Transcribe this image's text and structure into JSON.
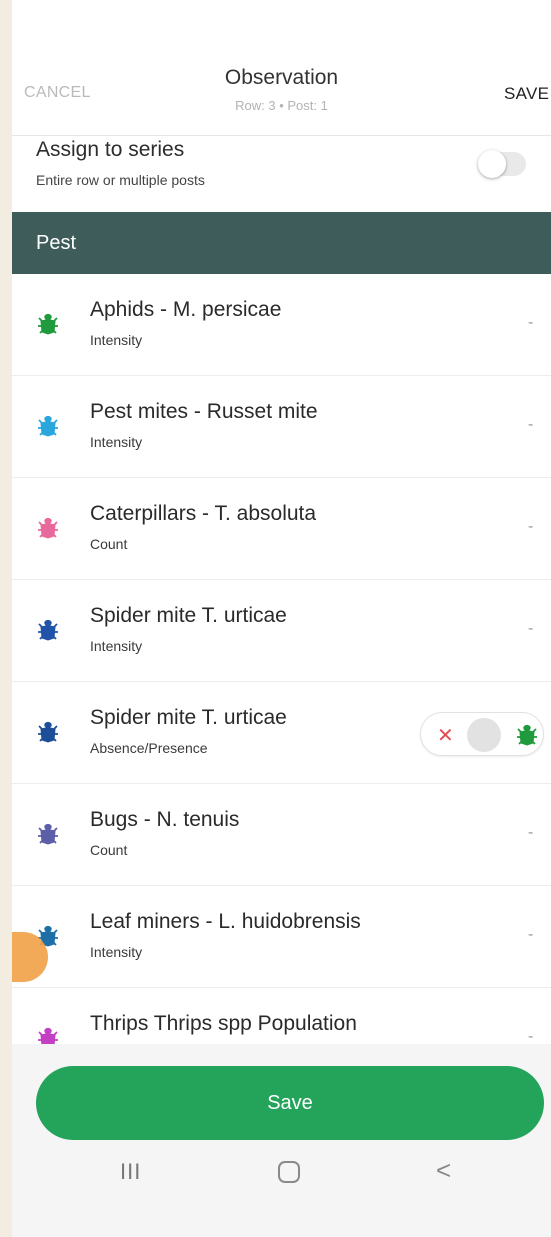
{
  "header": {
    "cancel_label": "CANCEL",
    "title": "Observation",
    "subtitle": "Row: 3 • Post: 1",
    "save_label": "SAVE"
  },
  "assign": {
    "title": "Assign to series",
    "subtitle": "Entire row or multiple posts",
    "enabled": false
  },
  "section": {
    "label": "Pest"
  },
  "items": [
    {
      "name": "Aphids - M. persicae",
      "metric": "Intensity",
      "value": "-",
      "icon": "bug-icon",
      "color": "#1f9a3c"
    },
    {
      "name": "Pest mites - Russet mite",
      "metric": "Intensity",
      "value": "-",
      "icon": "bug-icon",
      "color": "#2aa6de"
    },
    {
      "name": "Caterpillars - T. absoluta",
      "metric": "Count",
      "value": "-",
      "icon": "bug-icon",
      "color": "#e86a9d"
    },
    {
      "name": "Spider mite T. urticae",
      "metric": "Intensity",
      "value": "-",
      "icon": "bug-icon",
      "color": "#2154a8"
    },
    {
      "name": "Spider mite T. urticae",
      "metric": "Absence/Presence",
      "value": "",
      "icon": "bug-icon",
      "color": "#1d4f98"
    },
    {
      "name": "Bugs - N. tenuis",
      "metric": "Count",
      "value": "-",
      "icon": "bug-icon",
      "color": "#5c5ea8"
    },
    {
      "name": "Leaf miners - L. huidobrensis",
      "metric": "Intensity",
      "value": "-",
      "icon": "bug-icon",
      "color": "#1e6fa8"
    },
    {
      "name": "Thrips Thrips spp Population",
      "metric": "",
      "value": "-",
      "icon": "bug-icon",
      "color": "#c33fc4"
    }
  ],
  "absence_presence": {
    "absent_symbol": "✕",
    "absent_color": "#e44c55",
    "present_color": "#1f9a3c"
  },
  "save_button": {
    "label": "Save",
    "color": "#24a35a"
  },
  "nav": {
    "recent_symbol": "III",
    "back_symbol": "<"
  }
}
